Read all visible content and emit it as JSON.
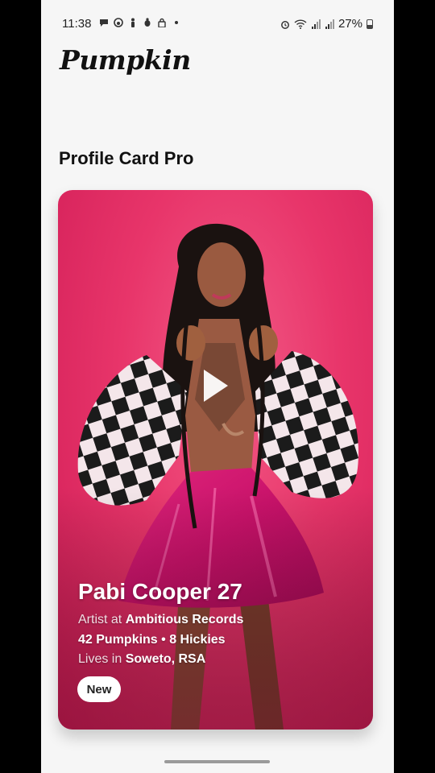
{
  "status_bar": {
    "time": "11:38",
    "left_icons": [
      "chat-icon",
      "face-icon",
      "figure-icon",
      "bug-icon",
      "lock-icon",
      "dot-icon"
    ],
    "right_icons": [
      "alarm-icon",
      "wifi-icon",
      "signal-icon",
      "signal-icon"
    ],
    "battery": "27%"
  },
  "brand": {
    "name": "Pumpkin"
  },
  "section": {
    "title": "Profile Card Pro"
  },
  "profile": {
    "name": "Pabi Cooper 27",
    "job_prefix": "Artist at",
    "job_company": "Ambitious Records",
    "stats": "42 Pumpkins • 8 Hickies",
    "home_prefix": "Lives in",
    "home_place": "Soweto, RSA",
    "badge": "New"
  },
  "colors": {
    "card_background": "#e8356a",
    "skirt": "#d81b73"
  }
}
